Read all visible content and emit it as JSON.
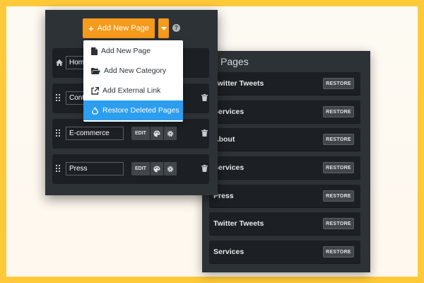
{
  "main": {
    "add_button_label": "Add New Page",
    "pages": [
      {
        "value": "Home",
        "icon": "home-icon"
      },
      {
        "value": "Contact",
        "icon": "drag-handle-icon"
      },
      {
        "value": "E-commerce",
        "icon": "drag-handle-icon"
      },
      {
        "value": "Press",
        "icon": "drag-handle-icon"
      }
    ],
    "edit_label": "EDIT"
  },
  "dropdown": {
    "items": [
      {
        "label": "Add New Page",
        "icon": "file-icon"
      },
      {
        "label": "Add New Category",
        "icon": "folder-open-icon"
      },
      {
        "label": "Add External Link",
        "icon": "external-link-icon"
      },
      {
        "label": "Restore Deleted Pages",
        "icon": "recycle-icon",
        "active": true
      }
    ]
  },
  "deleted": {
    "title": "Pages",
    "restore_label": "RESTORE",
    "items": [
      "Twitter Tweets",
      "Services",
      "About",
      "Services",
      "Press",
      "Twitter Tweets",
      "Services"
    ]
  },
  "colors": {
    "accent": "#f59a1b",
    "highlight": "#2c9ef0",
    "panel": "#2d3236",
    "row": "#1c2024",
    "frame": "#ffc93a"
  }
}
